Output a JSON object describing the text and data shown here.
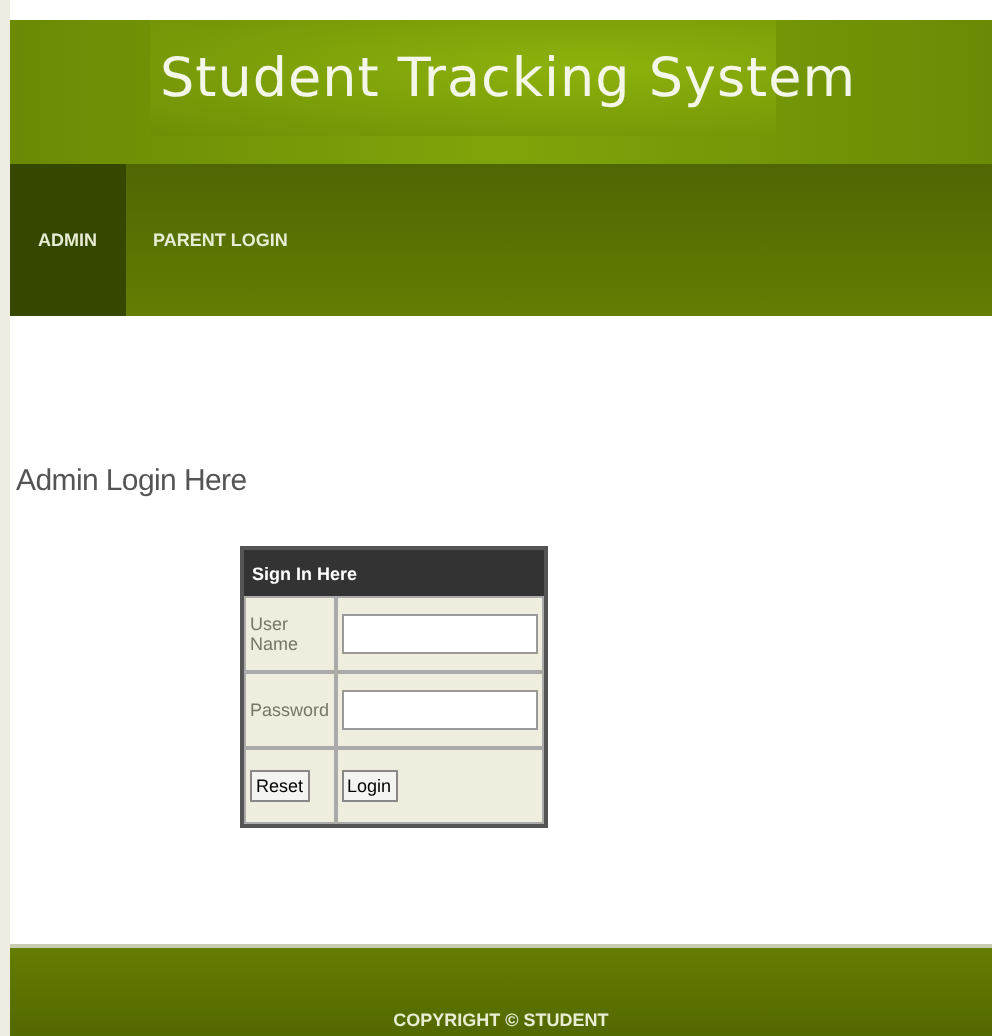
{
  "header": {
    "title": "Student Tracking System"
  },
  "nav": [
    {
      "label": "ADMIN",
      "selected": true
    },
    {
      "label": "PARENT LOGIN",
      "selected": false
    }
  ],
  "page_heading": "Admin Login Here",
  "login_form": {
    "caption": "Sign In Here",
    "fields": [
      {
        "label": "User Name"
      },
      {
        "label": "Password"
      }
    ],
    "buttons": [
      "Reset",
      "Login"
    ]
  },
  "footer": "COPYRIGHT © STUDENT"
}
